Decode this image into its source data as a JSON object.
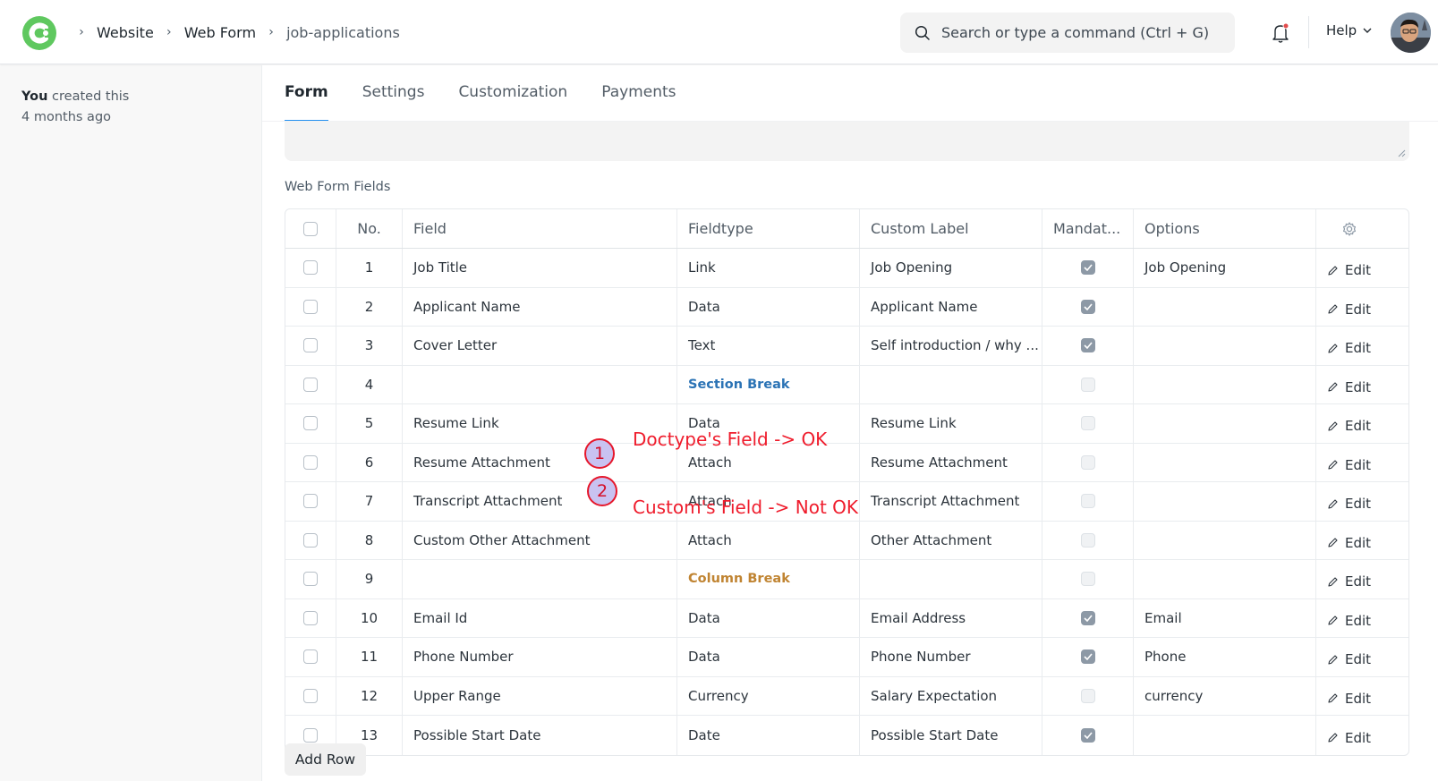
{
  "navbar": {
    "breadcrumbs": [
      "Website",
      "Web Form",
      "job-applications"
    ],
    "search_placeholder": "Search or type a command (Ctrl + G)",
    "help_label": "Help"
  },
  "sidebar": {
    "created_by": "You",
    "created_text": " created this",
    "created_when": "4 months ago"
  },
  "tabs": [
    "Form",
    "Settings",
    "Customization",
    "Payments"
  ],
  "section_label": "Web Form Fields",
  "grid": {
    "headers": [
      "No.",
      "Field",
      "Fieldtype",
      "Custom Label",
      "Mandat...",
      "Options"
    ],
    "edit_label": "Edit",
    "rows": [
      {
        "no": "1",
        "field": "Job Title",
        "type": "Link",
        "label": "Job Opening",
        "mandatory": true,
        "options": "Job Opening"
      },
      {
        "no": "2",
        "field": "Applicant Name",
        "type": "Data",
        "label": "Applicant Name",
        "mandatory": true,
        "options": ""
      },
      {
        "no": "3",
        "field": "Cover Letter",
        "type": "Text",
        "label": "Self introduction / why ...",
        "mandatory": true,
        "options": ""
      },
      {
        "no": "4",
        "field": "",
        "type": "Section Break",
        "label": "",
        "mandatory": false,
        "options": ""
      },
      {
        "no": "5",
        "field": "Resume Link",
        "type": "Data",
        "label": "Resume Link",
        "mandatory": false,
        "options": ""
      },
      {
        "no": "6",
        "field": "Resume Attachment",
        "type": "Attach",
        "label": "Resume Attachment",
        "mandatory": false,
        "options": ""
      },
      {
        "no": "7",
        "field": "Transcript Attachment",
        "type": "Attach",
        "label": "Transcript Attachment",
        "mandatory": false,
        "options": ""
      },
      {
        "no": "8",
        "field": "Custom Other Attachment",
        "type": "Attach",
        "label": "Other Attachment",
        "mandatory": false,
        "options": ""
      },
      {
        "no": "9",
        "field": "",
        "type": "Column Break",
        "label": "",
        "mandatory": false,
        "options": ""
      },
      {
        "no": "10",
        "field": "Email Id",
        "type": "Data",
        "label": "Email Address",
        "mandatory": true,
        "options": "Email"
      },
      {
        "no": "11",
        "field": "Phone Number",
        "type": "Data",
        "label": "Phone Number",
        "mandatory": true,
        "options": "Phone"
      },
      {
        "no": "12",
        "field": "Upper Range",
        "type": "Currency",
        "label": "Salary Expectation",
        "mandatory": false,
        "options": "currency"
      },
      {
        "no": "13",
        "field": "Possible Start Date",
        "type": "Date",
        "label": "Possible Start Date",
        "mandatory": true,
        "options": ""
      }
    ]
  },
  "add_row_label": "Add Row",
  "annotations": [
    {
      "number": "1",
      "text": "Doctype's Field -> OK"
    },
    {
      "number": "2",
      "text": "Custom's Field -> Not OK"
    }
  ],
  "colors": {
    "accent": "#2490ef",
    "logo": "#5fc85f",
    "section_break": "#2b73b5",
    "column_break": "#c08432",
    "annotation": "#ef1c2c"
  }
}
